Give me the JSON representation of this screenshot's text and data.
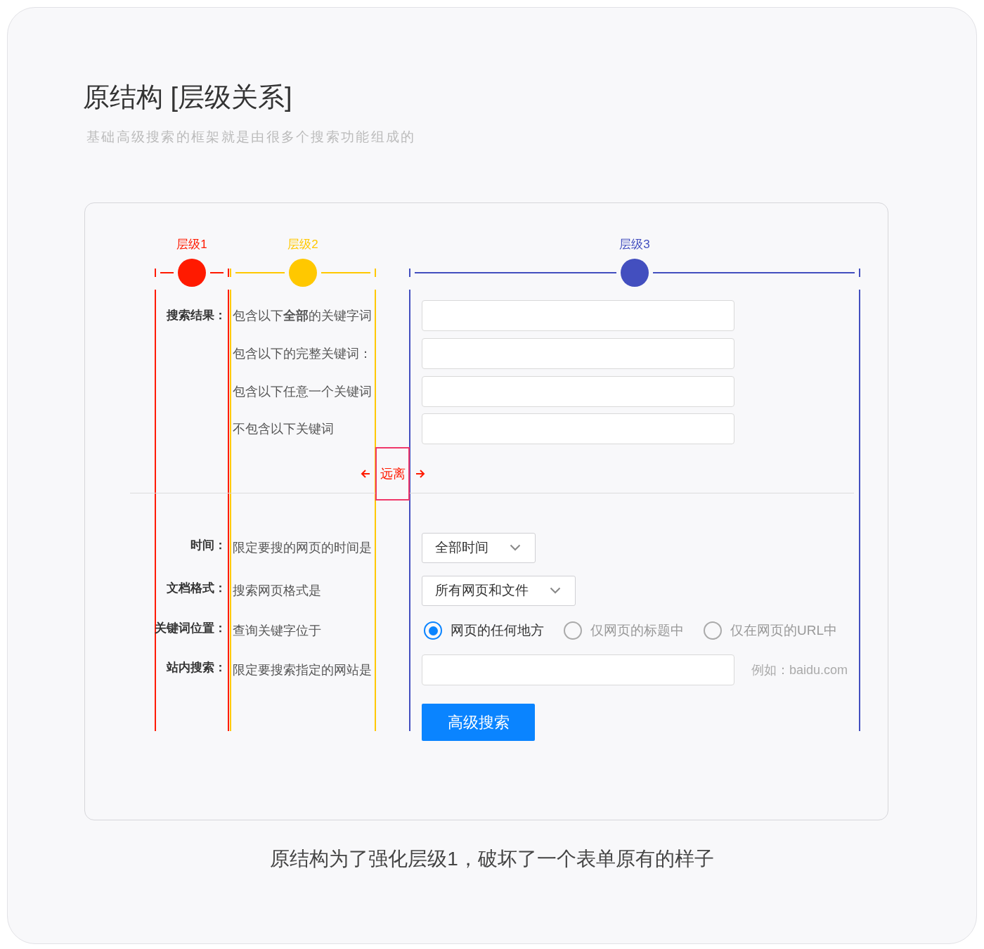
{
  "title": "原结构 [层级关系]",
  "subtitle": "基础高级搜索的框架就是由很多个搜索功能组成的",
  "levels": [
    {
      "label": "层级1",
      "color": "#ff1a00"
    },
    {
      "label": "层级2",
      "color": "#ffc800"
    },
    {
      "label": "层级3",
      "color": "#434fbf"
    }
  ],
  "keyword_section": {
    "label": "搜索结果：",
    "rows": [
      {
        "description": "包含以下**全部**的关键字词"
      },
      {
        "description": "包含以下的完整关键词："
      },
      {
        "description": "包含以下任意一个关键词"
      },
      {
        "description": "不包含以下关键词"
      }
    ]
  },
  "distance_note": "远离",
  "options": [
    {
      "kind": "select",
      "label": "时间：",
      "description": "限定要搜的网页的时间是",
      "value": "全部时间"
    },
    {
      "kind": "select",
      "label": "文档格式：",
      "description": "搜索网页格式是",
      "value": "所有网页和文件"
    },
    {
      "kind": "radio",
      "label": "关键词位置：",
      "description": "查询关键字位于",
      "choices": [
        {
          "label": "网页的任何地方",
          "selected": true
        },
        {
          "label": "仅网页的标题中",
          "selected": false
        },
        {
          "label": "仅在网页的URL中",
          "selected": false
        }
      ]
    },
    {
      "kind": "input",
      "label": "站内搜索：",
      "description": "限定要搜索指定的网站是",
      "hint": "例如：baidu.com"
    }
  ],
  "submit_button": "高级搜索",
  "caption": "原结构为了强化层级1，破坏了一个表单原有的样子"
}
